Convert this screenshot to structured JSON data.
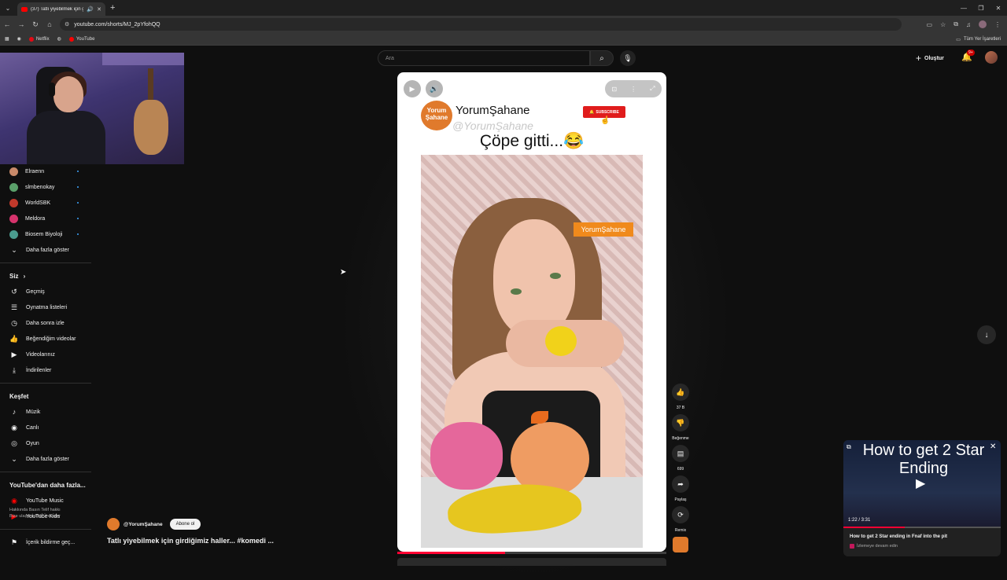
{
  "browser": {
    "tab_title": "(37) Tatlı yiyebilmek için gir…",
    "url": "youtube.com/shorts/MJ_2pYfohQQ",
    "bookmarks": [
      {
        "label": "Netflix",
        "color": "#e50914"
      },
      {
        "label": "YouTube",
        "color": "#ff0000"
      }
    ],
    "all_bookmarks_label": "Tüm Yer İşaretleri"
  },
  "header": {
    "search_placeholder": "Ara",
    "create_label": "Oluştur",
    "notification_count": "9+"
  },
  "sidebar": {
    "subscriptions": [
      {
        "label": "Elraenn",
        "color": "#c98a6a"
      },
      {
        "label": "slmbenokay",
        "color": "#5aa06a"
      },
      {
        "label": "WorldSBK",
        "color": "#c0392b"
      },
      {
        "label": "Meldora",
        "color": "#d6336c"
      },
      {
        "label": "Biosem Biyoloji",
        "color": "#4a9b8e"
      }
    ],
    "show_more": "Daha fazla göster",
    "you_heading": "Siz",
    "you_items": [
      {
        "label": "Geçmiş",
        "icon": "history-icon",
        "glyph": "↺"
      },
      {
        "label": "Oynatma listeleri",
        "icon": "playlists-icon",
        "glyph": "☰"
      },
      {
        "label": "Daha sonra izle",
        "icon": "watch-later-icon",
        "glyph": "◷"
      },
      {
        "label": "Beğendiğim videolar",
        "icon": "liked-videos-icon",
        "glyph": "👍"
      },
      {
        "label": "Videolarınız",
        "icon": "your-videos-icon",
        "glyph": "▶"
      },
      {
        "label": "İndirilenler",
        "icon": "downloads-icon",
        "glyph": "⤓"
      }
    ],
    "explore_heading": "Keşfet",
    "explore_items": [
      {
        "label": "Müzik",
        "icon": "music-icon",
        "glyph": "♪"
      },
      {
        "label": "Canlı",
        "icon": "live-icon",
        "glyph": "◉"
      },
      {
        "label": "Oyun",
        "icon": "gaming-icon",
        "glyph": "◎"
      }
    ],
    "explore_more": "Daha fazla göster",
    "more_heading": "YouTube'dan daha fazla...",
    "more_items": [
      {
        "label": "YouTube Music",
        "color": "#ff0000"
      },
      {
        "label": "YouTube Kids",
        "color": "#ff0000"
      }
    ],
    "report": "İçerik bildirme geç...",
    "footer_line1": "Hakkında  Basın  Telif hakkı",
    "footer_line2": "Bize ulaşın  İçerik Üreticiler"
  },
  "short": {
    "channel_display_name": "YorumŞahane",
    "channel_handle_overlay": "@YorumŞahane",
    "channel_logo_text": "Yorum Şahane",
    "subscribe_overlay": "SUBSCRIBE",
    "overlay_title": "Çöpe gitti...😂",
    "watermark": "YorumŞahane",
    "progress": 0.4,
    "channel_handle": "@YorumŞahane",
    "subscribe_button": "Abone ol",
    "description": "Tatlı yiyebilmek için girdiğimiz haller... #komedi ..."
  },
  "actions": {
    "like_count": "37 B",
    "dislike_label": "Beğenme",
    "comments_count": "699",
    "share_label": "Paylaş",
    "remix_label": "Remix"
  },
  "miniplayer": {
    "overlay_title": "How to get 2 Star Ending",
    "time": "1:22 / 3:31",
    "progress": 0.39,
    "title": "How to get 2 Star ending in Fnaf into the pit",
    "subtitle": "İzlemeye devam edin"
  }
}
